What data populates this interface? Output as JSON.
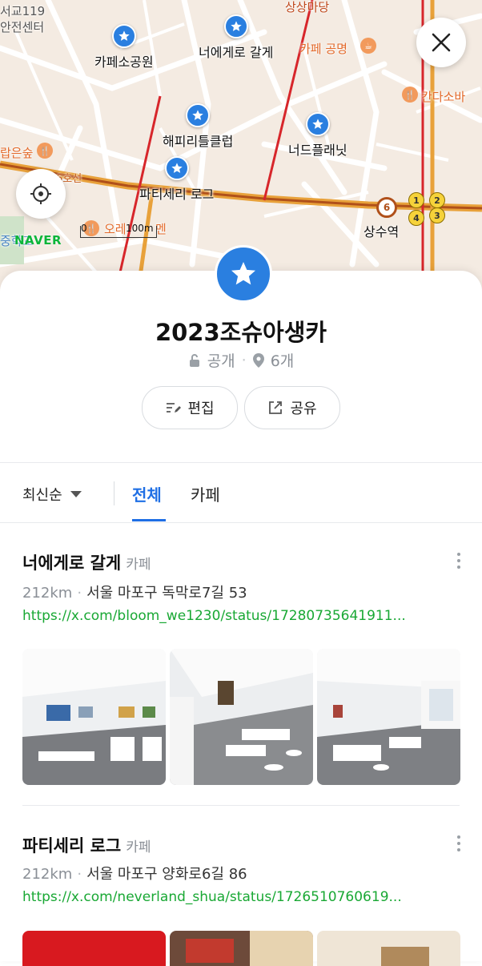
{
  "map": {
    "pois": [
      {
        "name": "카페소공원"
      },
      {
        "name": "너에게로 갈게"
      },
      {
        "name": "해피리틀클럽"
      },
      {
        "name": "너드플래닛"
      },
      {
        "name": "파티세리 로그"
      }
    ],
    "labels": {
      "fire_station_1": "서교119",
      "fire_station_2": "안전센터",
      "sangsang_madang": "상상마당",
      "cafe_gongmyeong": "카페 공명",
      "kandasoba": "칸다소바",
      "line6": "6호선",
      "orae": "오레",
      "men": "멘",
      "station": "상수역",
      "left_cafe": "랍은숲",
      "left_bottom": "중학교"
    },
    "line_number": "6",
    "station_numbers": [
      "1",
      "2",
      "4",
      "3"
    ],
    "scale": {
      "start": "0",
      "distance": "100m"
    },
    "brand": "NAVER",
    "colors": {
      "pin": "#2a7fe0",
      "brand": "#0bb53a",
      "line6": "#b0501a"
    }
  },
  "list": {
    "title": "2023조슈아생카",
    "visibility": "공개",
    "place_count": "6개",
    "edit_label": "편집",
    "share_label": "공유"
  },
  "filters": {
    "sort": "최신순",
    "tabs": [
      "전체",
      "카페"
    ],
    "active_tab": "전체",
    "accent": "#1f6fe5"
  },
  "items": [
    {
      "name": "너에게로 갈게",
      "category": "카페",
      "distance": "212km",
      "address": "서울 마포구 독막로7길 53",
      "link": "https://x.com/bloom_we1230/status/17280735641911..."
    },
    {
      "name": "파티세리 로그",
      "category": "카페",
      "distance": "212km",
      "address": "서울 마포구 양화로6길 86",
      "link": "https://x.com/neverland_shua/status/1726510760619..."
    }
  ]
}
